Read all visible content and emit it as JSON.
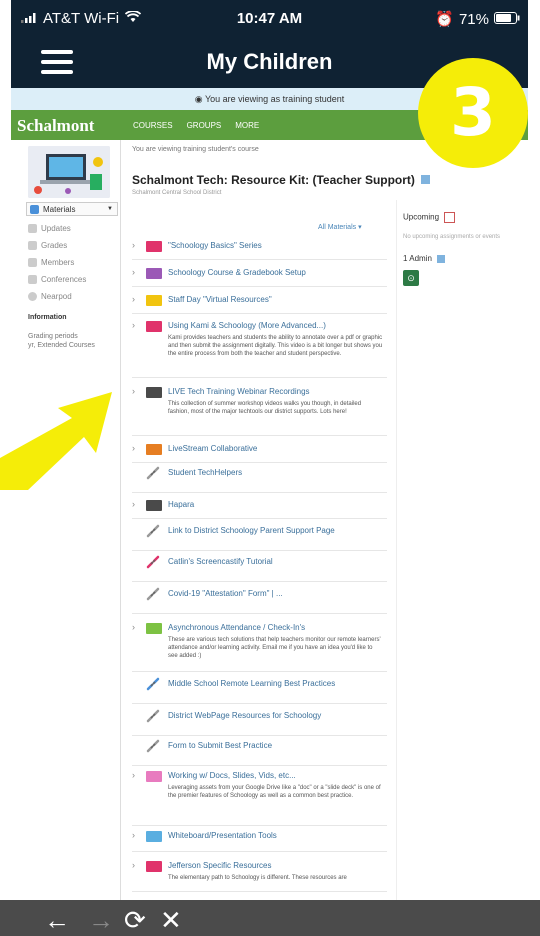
{
  "status_bar": {
    "carrier": "AT&T Wi-Fi",
    "time": "10:47 AM",
    "battery": "71%"
  },
  "nav": {
    "title": "My Children"
  },
  "training_banner": "You are viewing as training student",
  "schoology_bar": {
    "logo": "Schalmont",
    "menu": [
      "COURSES",
      "GROUPS",
      "MORE"
    ]
  },
  "sidebar": {
    "materials_label": "Materials",
    "items": [
      "Updates",
      "Grades",
      "Members",
      "Conferences",
      "Nearpod"
    ],
    "info_heading": "Information",
    "grading_periods_label": "Grading periods",
    "grading_periods_value": "yr, Extended Courses"
  },
  "course": {
    "viewing_note": "You are viewing training student's course",
    "title": "Schalmont Tech: Resource Kit: (Teacher Support)",
    "district": "Schalmont Central School District",
    "filter_label": "All Materials"
  },
  "upcoming": {
    "header": "Upcoming",
    "none_text": "No upcoming assignments or events",
    "admin_label": "1 Admin"
  },
  "materials": [
    {
      "type": "folder",
      "color": "#e0336b",
      "label": "\"Schoology Basics\" Series",
      "desc": ""
    },
    {
      "type": "folder",
      "color": "#9b59b6",
      "label": "Schoology Course & Gradebook Setup",
      "desc": ""
    },
    {
      "type": "folder",
      "color": "#f1c40f",
      "label": "Staff Day \"Virtual Resources\"",
      "desc": ""
    },
    {
      "type": "folder",
      "color": "#e0336b",
      "label": "Using Kami & Schoology (More Advanced...)",
      "desc": "Kami provides teachers and students the ability to annotate over a pdf or graphic and then submit the assignment digitally. This video is a bit longer but shows you the entire process from both the teacher and student perspective."
    },
    {
      "type": "folder",
      "color": "#4a4a4a",
      "label": "LIVE Tech Training Webinar Recordings",
      "desc": "This collection of summer workshop videos walks you though, in detailed fashion, most of the major techtools our district supports. Lots here!"
    },
    {
      "type": "folder",
      "color": "#e67e22",
      "label": "LiveStream Collaborative",
      "desc": ""
    },
    {
      "type": "link",
      "color": "#999999",
      "label": "Student TechHelpers",
      "desc": ""
    },
    {
      "type": "folder",
      "color": "#4a4a4a",
      "label": "Hapara",
      "desc": ""
    },
    {
      "type": "link",
      "color": "#999999",
      "label": "Link to District Schoology Parent Support Page",
      "desc": ""
    },
    {
      "type": "link",
      "color": "#e0336b",
      "label": "Catlin's Screencastify Tutorial",
      "desc": ""
    },
    {
      "type": "link",
      "color": "#999999",
      "label": "Covid-19 \"Attestation\" Form\" | ...",
      "desc": ""
    },
    {
      "type": "folder",
      "color": "#7dc243",
      "label": "Asynchronous Attendance / Check-In's",
      "desc": "These are various tech solutions that help teachers monitor our remote learners' attendance and/or learning activity. Email me if you have an idea you'd like to see added :)"
    },
    {
      "type": "link",
      "color": "#4a90d9",
      "label": "Middle School Remote Learning Best Practices",
      "desc": ""
    },
    {
      "type": "link",
      "color": "#999999",
      "label": "District WebPage Resources for Schoology",
      "desc": ""
    },
    {
      "type": "link",
      "color": "#999999",
      "label": "Form to Submit Best Practice",
      "desc": ""
    },
    {
      "type": "folder",
      "color": "#e87bbf",
      "label": "Working w/ Docs, Slides, Vids, etc...",
      "desc": "Leveraging assets from your Google Drive like a \"doc\" or a \"slide deck\" is one of the premier features of Schoology as well as a common best practice."
    },
    {
      "type": "folder",
      "color": "#5aaee0",
      "label": "Whiteboard/Presentation Tools",
      "desc": ""
    },
    {
      "type": "folder",
      "color": "#e0336b",
      "label": "Jefferson Specific Resources",
      "desc": "The elementary path to Schoology is different. These resources are"
    }
  ],
  "badge": "3",
  "browser_controls": [
    "back",
    "forward",
    "reload",
    "close"
  ]
}
